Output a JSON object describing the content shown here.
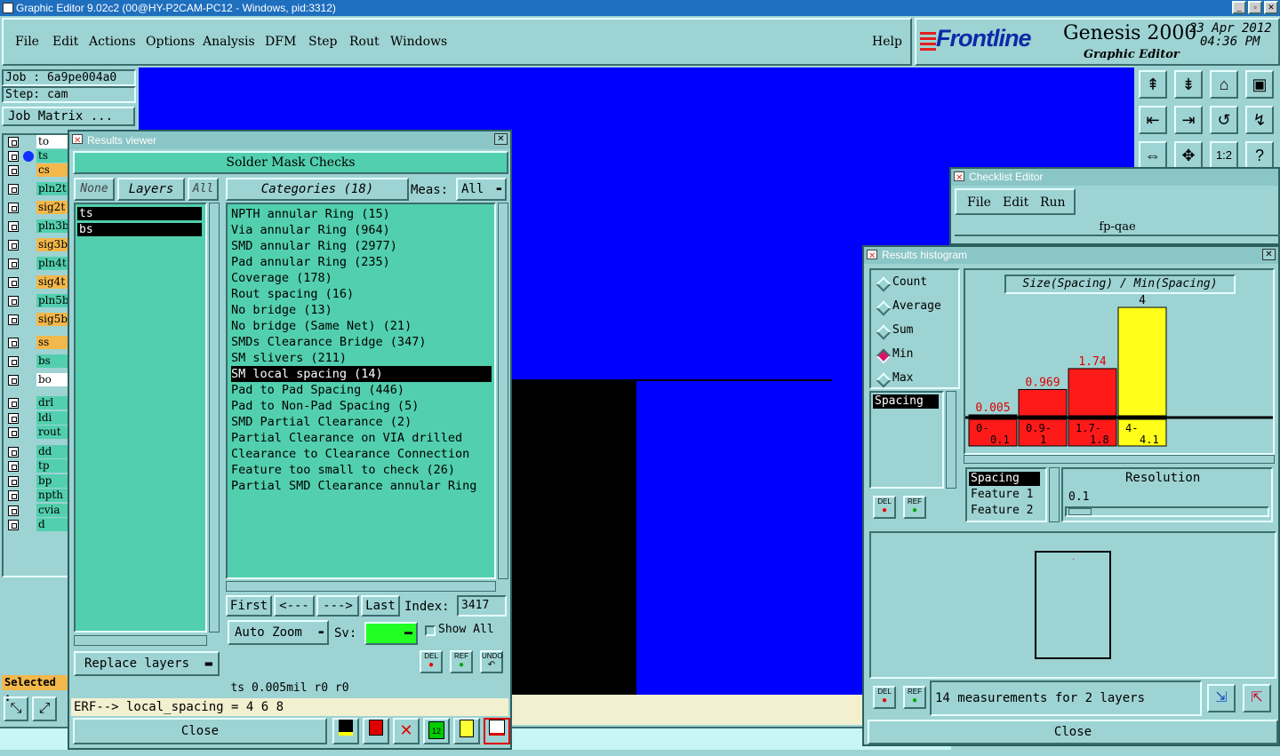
{
  "window": {
    "title": "Graphic Editor 9.02c2 (00@HY-P2CAM-PC12 - Windows, pid:3312)"
  },
  "menu": {
    "items": [
      "File",
      "Edit",
      "Actions",
      "Options",
      "Analysis",
      "DFM",
      "Step",
      "Rout",
      "Windows"
    ],
    "help": "Help"
  },
  "brand": {
    "logo": "Frontline",
    "product": "Genesis 2000",
    "subtitle": "Graphic Editor",
    "date": "23 Apr 2012",
    "time": "04:36 PM"
  },
  "job": {
    "job_line": "Job  :  6a9pe004a0",
    "step_line": "Step: cam",
    "matrix_btn": "Job Matrix ..."
  },
  "layers": [
    "to",
    "ts",
    "cs",
    "pln2t",
    "sig2t",
    "pln3b",
    "sig3b",
    "pln4t",
    "sig4t",
    "pln5b",
    "sig5b",
    "ss",
    "bs",
    "bo",
    "drl",
    "ldi",
    "rout",
    "dd",
    "tp",
    "bp",
    "npth",
    "cvia",
    "d"
  ],
  "selected_label": "Selected :",
  "results_viewer": {
    "title": "Results viewer",
    "header": "Solder Mask Checks",
    "none_btn": "None",
    "layers_btn": "Layers",
    "all_btn": "All",
    "categories_btn": "Categories (18)",
    "meas_label": "Meas:",
    "meas_value": "All",
    "layer_list": [
      "ts",
      "bs"
    ],
    "categories": [
      "NPTH annular Ring (15)",
      "Via annular Ring (964)",
      "SMD annular Ring (2977)",
      "Pad annular Ring (235)",
      "Coverage (178)",
      "Rout spacing (16)",
      "No bridge (13)",
      "No bridge (Same Net) (21)",
      "SMDs Clearance Bridge (347)",
      "SM slivers (211)",
      "SM local spacing (14)",
      "Pad to Pad Spacing (446)",
      "Pad to Non-Pad Spacing (5)",
      "SMD Partial Clearance (2)",
      "Partial Clearance on VIA drilled",
      "Clearance to Clearance Connection",
      "Feature too small to check (26)",
      "Partial SMD Clearance annular Ring"
    ],
    "selected_category": "SM local spacing (14)",
    "nav": {
      "first": "First",
      "prev": "<---",
      "next": "--->",
      "last": "Last",
      "index_label": "Index:",
      "index_value": "3417"
    },
    "auto_zoom": "Auto Zoom",
    "sv_label": "Sv:",
    "show_all": "Show All",
    "replace_layers": "Replace layers",
    "status": "ts 0.005mil  r0  r0",
    "erf": "ERF--> local_spacing = 4 6 8",
    "close": "Close",
    "del": "DEL",
    "ref": "REF",
    "undo": "UNDO"
  },
  "checklist": {
    "title": "Checklist Editor",
    "menu": [
      "File",
      "Edit",
      "Run"
    ],
    "name": "fp-qae"
  },
  "histogram": {
    "title": "Results histogram",
    "modes": [
      "Count",
      "Average",
      "Sum",
      "Min",
      "Max"
    ],
    "selected_mode": "Min",
    "attr_list": [
      "Spacing"
    ],
    "chart_title": "Size(Spacing) / Min(Spacing)",
    "fields": [
      "Spacing",
      "Feature 1",
      "Feature 2"
    ],
    "resolution_label": "Resolution",
    "resolution_value": "0.1",
    "status": "14 measurements for 2 layers",
    "close": "Close",
    "del": "DEL",
    "ref": "REF"
  },
  "chart_data": {
    "type": "bar",
    "title": "Size(Spacing) / Min(Spacing)",
    "categories": [
      "0-0.1",
      "0.9-1",
      "1.7-1.8",
      "4-4.1"
    ],
    "values": [
      0.005,
      0.969,
      1.74,
      4
    ],
    "value_labels": [
      "0.005",
      "0.969",
      "1.74",
      "4"
    ],
    "ylim": [
      0,
      4
    ],
    "colors": [
      "#ff1a1a",
      "#ff1a1a",
      "#ff1a1a",
      "#ffff1a"
    ]
  },
  "colors": {
    "panel": "#9ed3d3",
    "green": "#52cfae",
    "canvas_blue": "#0000ff",
    "title_blue": "#1f6fbf",
    "selected_layer": "#f2b84b"
  }
}
